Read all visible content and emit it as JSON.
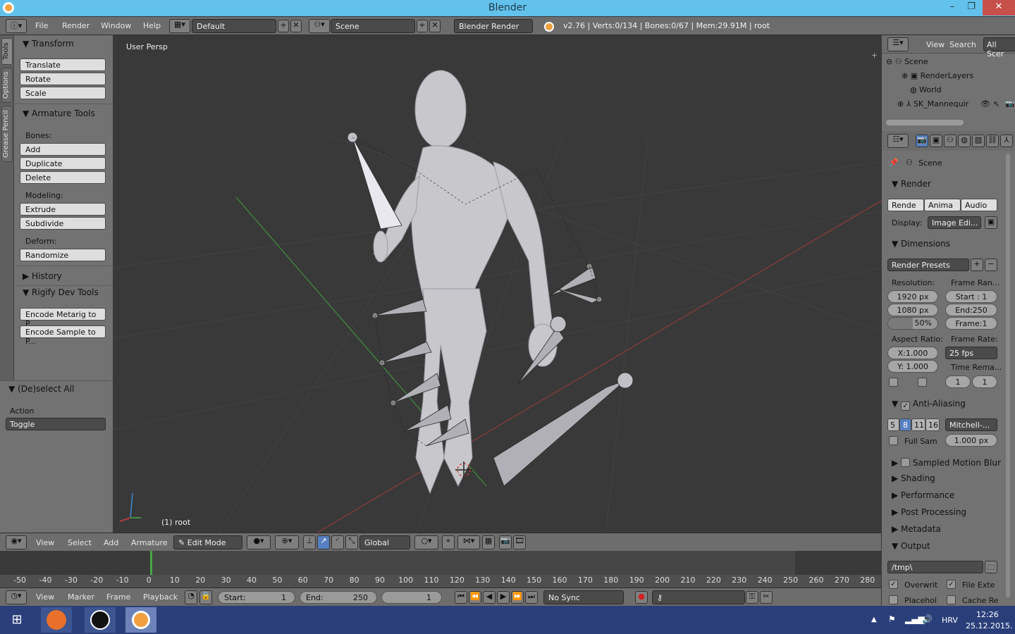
{
  "window": {
    "title": "Blender"
  },
  "topbar": {
    "menus": [
      "File",
      "Render",
      "Window",
      "Help"
    ],
    "screen_layout": "Default",
    "scene": "Scene",
    "engine": "Blender Render",
    "stats": "v2.76 | Verts:0/134 | Bones:0/67 | Mem:29.91M | root"
  },
  "tool_tabs": [
    "Tools",
    "Options",
    "Grease Pencil"
  ],
  "left_panel": {
    "transform": {
      "title": "Transform",
      "buttons": [
        "Translate",
        "Rotate",
        "Scale"
      ]
    },
    "armature": {
      "title": "Armature Tools",
      "bones_label": "Bones:",
      "bones": [
        "Add",
        "Duplicate",
        "Delete"
      ],
      "modeling_label": "Modeling:",
      "modeling": [
        "Extrude",
        "Subdivide"
      ],
      "deform_label": "Deform:",
      "deform": [
        "Randomize"
      ]
    },
    "history": "History",
    "rigify": {
      "title": "Rigify Dev Tools",
      "buttons": [
        "Encode Metarig to P...",
        "Encode Sample to P..."
      ]
    },
    "operator": {
      "title": "(De)select All",
      "action_label": "Action",
      "action_value": "Toggle"
    }
  },
  "viewport": {
    "view_label": "User Persp",
    "object_label": "(1) root"
  },
  "view_header": {
    "menus": [
      "View",
      "Select",
      "Add",
      "Armature"
    ],
    "mode": "Edit Mode",
    "orientation": "Global"
  },
  "timeline": {
    "ticks": [
      "-50",
      "-40",
      "-30",
      "-20",
      "-10",
      "0",
      "10",
      "20",
      "30",
      "40",
      "50",
      "60",
      "70",
      "80",
      "90",
      "100",
      "110",
      "120",
      "130",
      "140",
      "150",
      "160",
      "170",
      "180",
      "190",
      "200",
      "210",
      "220",
      "230",
      "240",
      "250",
      "260",
      "270",
      "280"
    ],
    "menus": [
      "View",
      "Marker",
      "Frame",
      "Playback"
    ],
    "start_label": "Start:",
    "start": "1",
    "end_label": "End:",
    "end": "250",
    "current": "1",
    "sync": "No Sync"
  },
  "outliner": {
    "menus": [
      "View",
      "Search"
    ],
    "filter": "All Scer",
    "items": [
      "Scene",
      "RenderLayers",
      "World",
      "SK_Mannequir"
    ]
  },
  "properties": {
    "context": "Scene",
    "render": {
      "title": "Render",
      "buttons": [
        "Rende",
        "Anima",
        "Audio"
      ],
      "display_label": "Display:",
      "display": "Image Edi..."
    },
    "dimensions": {
      "title": "Dimensions",
      "presets": "Render Presets",
      "resolution_label": "Resolution:",
      "res_x": "1920 px",
      "res_y": "1080 px",
      "res_pct": "50%",
      "frame_range_label": "Frame Ran...",
      "start": "Start : 1",
      "end": "End:250",
      "frame": "Frame:1",
      "aspect_label": "Aspect Ratio:",
      "aspect_x": "X:1.000",
      "aspect_y": "Y: 1.000",
      "frame_rate_label": "Frame Rate:",
      "fps": "25 fps",
      "time_remap_label": "Time Rema...",
      "remap_old": "1",
      "remap_new": "1"
    },
    "aa": {
      "title": "Anti-Aliasing",
      "samples": [
        "5",
        "8",
        "11",
        "16"
      ],
      "filter": "Mitchell-...",
      "full_sample": "Full Sam",
      "size": "1.000 px"
    },
    "sections": [
      "Sampled Motion Blur",
      "Shading",
      "Performance",
      "Post Processing",
      "Metadata"
    ],
    "output": {
      "title": "Output",
      "path": "/tmp\\",
      "overwrite": "Overwrit",
      "file_ext": "File Exte",
      "placeholders": "Placehol",
      "cache": "Cache Re"
    }
  },
  "taskbar": {
    "lang": "HRV",
    "time": "12:26",
    "date": "25.12.2015."
  },
  "colors": {
    "accent": "#5680c2",
    "titlebar": "#62c2ec",
    "taskbar": "#2a3f7a"
  }
}
